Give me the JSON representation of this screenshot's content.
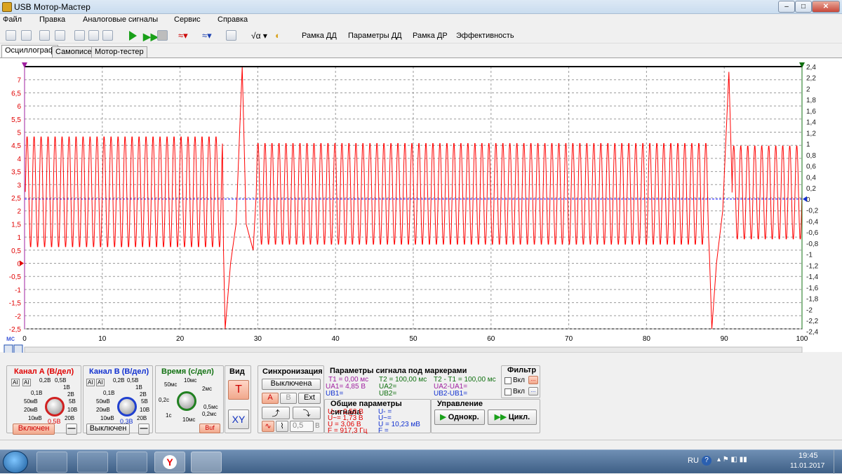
{
  "window": {
    "title": "USB Мотор-Мастер",
    "min": "–",
    "max": "□",
    "close": "✕"
  },
  "menu": [
    "Файл",
    "Правка",
    "Аналоговые сигналы",
    "Сервис",
    "Справка"
  ],
  "toolbar": {
    "buttons": [
      "Рамка ДД",
      "Параметры ДД",
      "Рамка ДР",
      "Эффективность"
    ]
  },
  "tabs": [
    "Осциллограф",
    "Самописец",
    "Мотор-тестер"
  ],
  "chart_data": {
    "type": "line",
    "xlabel": "мс",
    "xlim": [
      0,
      100
    ],
    "x_ticks": [
      0,
      10,
      20,
      30,
      40,
      50,
      60,
      70,
      80,
      90,
      100
    ],
    "y_left_lim": [
      -2.5,
      7.5
    ],
    "y_left_ticks": [
      "7",
      "6,5",
      "6",
      "5,5",
      "5",
      "4,5",
      "4",
      "3,5",
      "3",
      "2,5",
      "2",
      "1,5",
      "1",
      "0,5",
      "0",
      "-0,5",
      "-1",
      "-1,5",
      "-2",
      "-2,5"
    ],
    "y_right_ticks": [
      "2,4",
      "2,2",
      "2",
      "1,8",
      "1,6",
      "1,4",
      "1,2",
      "1",
      "0,8",
      "0,6",
      "0,4",
      "0,2",
      "0",
      "-0,2",
      "-0,4",
      "-0,6",
      "-0,8",
      "-1",
      "-1,2",
      "-1,4",
      "-1,6",
      "-1,8",
      "-2",
      "-2,2",
      "-2,4"
    ],
    "series": [
      {
        "name": "A",
        "color": "#ff0000",
        "segments": [
          {
            "from": 0.1,
            "to": 25.5,
            "period": 0.9,
            "high": 4.85,
            "low": 0.6
          },
          {
            "from": 29.8,
            "to": 88.0,
            "period": 0.9,
            "high": 4.6,
            "low": 0.7
          },
          {
            "from": 91.0,
            "to": 100,
            "period": 0.9,
            "high": 4.5,
            "low": 0.9
          }
        ],
        "events": [
          {
            "x": 25.8,
            "y": -2.5
          },
          {
            "x": 28.0,
            "y": 7.5
          },
          {
            "x": 88.4,
            "y": -2.5
          },
          {
            "x": 90.6,
            "y": 7.3
          }
        ]
      },
      {
        "name": "B",
        "color": "#0000ff",
        "level": 2.45
      }
    ],
    "grid": true
  },
  "panels": {
    "chA": {
      "title": "Канал А (В/дел)",
      "labels": [
        "0,2В",
        "0,5В",
        "1В",
        "2В",
        "5В",
        "10В",
        "20В",
        "50мВ",
        "20мВ",
        "10мВ",
        "0,1В"
      ],
      "value": "0,5В",
      "btn": "Включен",
      "minus": "—"
    },
    "chB": {
      "title": "Канал В (В/дел)",
      "labels": [
        "0,2В",
        "0,5В",
        "1В",
        "2В",
        "5В",
        "10В",
        "20В",
        "50мВ",
        "20мВ",
        "10мВ",
        "0,1В"
      ],
      "value": "0,3В",
      "btn": "Выключен",
      "minus": "—"
    },
    "time": {
      "title": "Время (с/дел)",
      "labels": [
        "10мс",
        "2мс",
        "50мс",
        "0,5мс",
        "0,2с",
        "1с",
        "10мс",
        "0,2мс"
      ],
      "buf": "Buf"
    },
    "view": {
      "title": "Вид",
      "t": "T",
      "xy": "XY"
    },
    "sync": {
      "title": "Синхронизация",
      "btn": "Выключена",
      "a": "A",
      "b": "B",
      "ext": "Ext",
      "level": "0,5",
      "unit": "В"
    },
    "markers": {
      "title": "Параметры сигнала под маркерами",
      "t1": "T1 = 0,00 мс",
      "ua1": "UA1= 4,85 В",
      "ub1": "UB1=",
      "t2": "T2 = 100,00 мс",
      "ua2": "UA2=",
      "ub2": "UB2=",
      "dt": "T2 - T1 = 100,00 мс",
      "dua": "UA2-UA1=",
      "dub": "UB2-UB1="
    },
    "general": {
      "title": "Общие параметры сигнала",
      "a1": "U- = 2,53 В",
      "a2": "U~= 1,73 В",
      "a3": "U = 3,06 В",
      "a4": "F = 917,3 Гц",
      "b1": "U- =",
      "b2": "U~=",
      "b3": "U = 10,23 мВ",
      "b4": "F ="
    },
    "filter": {
      "title": "Фильтр",
      "on1": "Вкл",
      "on2": "Вкл",
      "dots": "..."
    },
    "control": {
      "title": "Управление",
      "single": "Однокр.",
      "cycle": "Цикл."
    }
  },
  "tray": {
    "lang": "RU",
    "time": "19:45",
    "date": "11.01.2017"
  }
}
